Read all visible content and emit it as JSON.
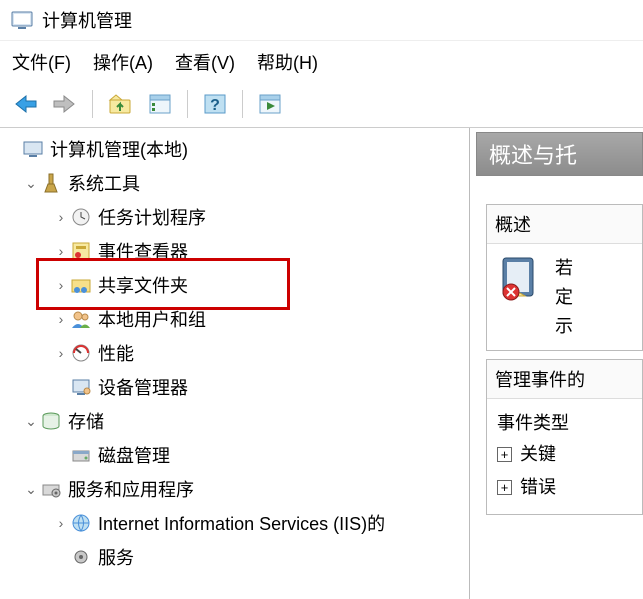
{
  "window": {
    "title": "计算机管理"
  },
  "menu": {
    "file": "文件(F)",
    "action": "操作(A)",
    "view": "查看(V)",
    "help": "帮助(H)"
  },
  "tree": {
    "root": "计算机管理(本地)",
    "system_tools": "系统工具",
    "task_scheduler": "任务计划程序",
    "event_viewer": "事件查看器",
    "shared_folders": "共享文件夹",
    "local_users": "本地用户和组",
    "performance": "性能",
    "device_manager": "设备管理器",
    "storage": "存储",
    "disk_mgmt": "磁盘管理",
    "services_apps": "服务和应用程序",
    "iis": "Internet Information Services (IIS)的",
    "services": "服务"
  },
  "right": {
    "header": "概述与托",
    "overview_title": "概述",
    "overview_text1": "若",
    "overview_text2": "定",
    "overview_text3": "示",
    "admin_events_title": "管理事件的",
    "event_types_title": "事件类型",
    "critical": "关键",
    "error": "错误"
  }
}
